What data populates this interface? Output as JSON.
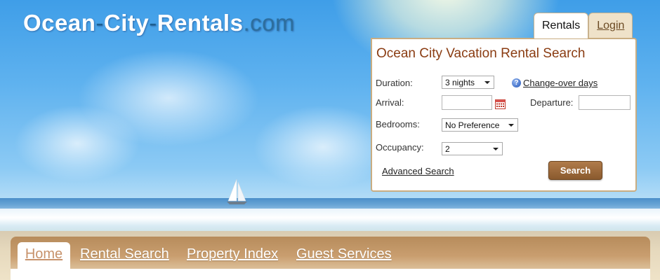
{
  "logo": {
    "word1": "Ocean",
    "sep1": "-",
    "word2": "City",
    "sep2": "-",
    "word3": "Rentals",
    "tld": ".com"
  },
  "widget": {
    "tabs": [
      {
        "label": "Rentals"
      },
      {
        "label": "Login"
      }
    ],
    "title": "Ocean City Vacation Rental Search",
    "duration": {
      "label": "Duration:",
      "value": "3 nights"
    },
    "change_over_link": "Change-over days",
    "help_icon_glyph": "?",
    "arrival": {
      "label": "Arrival:",
      "value": ""
    },
    "departure": {
      "label": "Departure:",
      "value": ""
    },
    "bedrooms": {
      "label": "Bedrooms:",
      "value": "No Preference"
    },
    "occupancy": {
      "label": "Occupancy:",
      "value": "2"
    },
    "advanced_link": "Advanced Search",
    "search_button": "Search"
  },
  "nav": {
    "items": [
      {
        "label": "Home",
        "active": true
      },
      {
        "label": "Rental Search"
      },
      {
        "label": "Property Index"
      },
      {
        "label": "Guest Services"
      }
    ]
  },
  "colors": {
    "title": "#8a3c12",
    "button": "#8a5a2e",
    "nav_bar": "#c99e6f",
    "nav_active_text": "#c7926b"
  }
}
